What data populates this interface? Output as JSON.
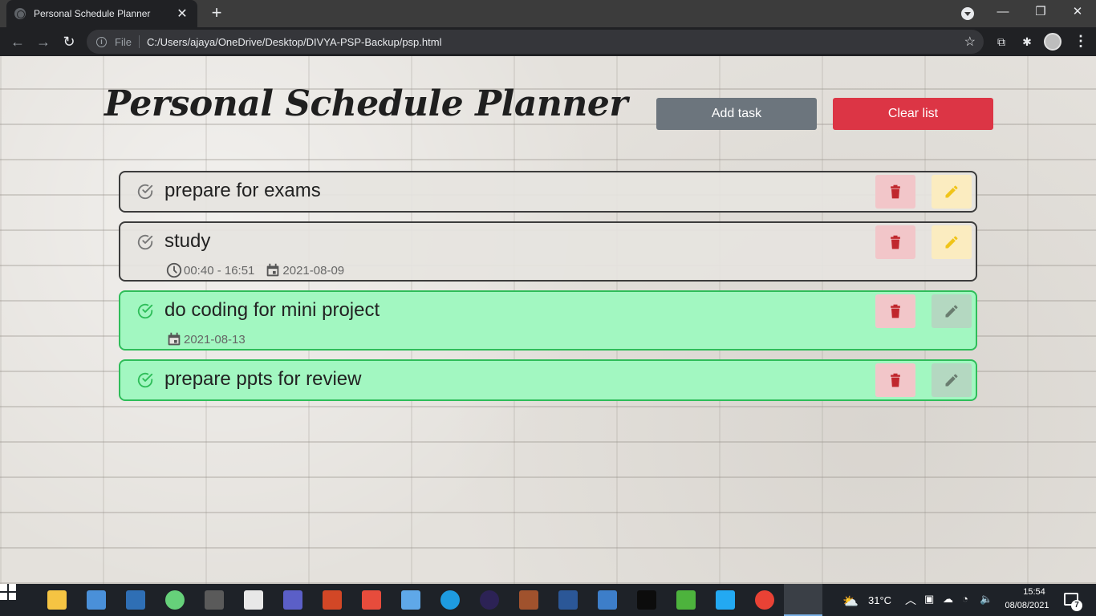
{
  "browser": {
    "tab_title": "Personal Schedule Planner",
    "scheme_label": "File",
    "url": "C:/Users/ajaya/OneDrive/Desktop/DIVYA-PSP-Backup/psp.html"
  },
  "app": {
    "title": "Personal Schedule Planner",
    "add_task_label": "Add task",
    "clear_list_label": "Clear list",
    "colors": {
      "add_button": "#6c757d",
      "clear_button": "#dc3545",
      "done_border": "#2ebd59",
      "done_background": "#a2f7c1",
      "delete_icon": "#c0272d",
      "edit_icon_pending": "#f0c419",
      "edit_icon_done": "#6a7d70"
    }
  },
  "tasks": [
    {
      "text": "prepare for exams",
      "done": false,
      "time": "",
      "date": ""
    },
    {
      "text": "study",
      "done": false,
      "time": "00:40 - 16:51",
      "date": "2021-08-09"
    },
    {
      "text": "do coding for mini project",
      "done": true,
      "time": "",
      "date": "2021-08-13"
    },
    {
      "text": "prepare ppts for review",
      "done": true,
      "time": "",
      "date": ""
    }
  ],
  "taskbar": {
    "apps": [
      "file-explorer",
      "laptop",
      "monitor",
      "atom",
      "terminal",
      "document",
      "teams",
      "powerpoint",
      "office",
      "photos",
      "edge",
      "eclipse",
      "winrar",
      "word",
      "virtualbox",
      "cmd",
      "mongodb",
      "vscode",
      "chrome"
    ],
    "weather": "31°C",
    "time": "15:54",
    "date": "08/08/2021",
    "notification_count": "7"
  }
}
